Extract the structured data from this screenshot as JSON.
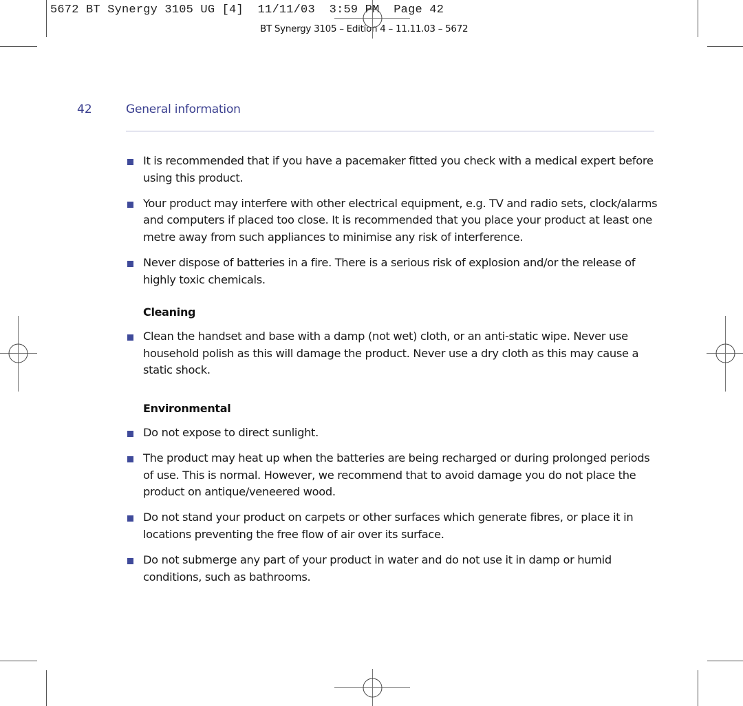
{
  "print_slug": "5672 BT Synergy 3105 UG [4]  11/11/03  3:59 PM  Page 42",
  "edition_line": "BT Synergy 3105 – Edition 4 – 11.11.03 – 5672",
  "header": {
    "page_number": "42",
    "section_title": "General information"
  },
  "intro_bullets": [
    "It is recommended that if you have a pacemaker fitted you check with a medical expert before using this product.",
    "Your product may interfere with other electrical equipment, e.g. TV and radio sets, clock/alarms and computers if placed too close. It is recommended that you place your product at least one metre away from such appliances to minimise any risk of interference.",
    "Never dispose of batteries in a fire. There is a serious risk of explosion and/or the release of highly toxic chemicals."
  ],
  "cleaning": {
    "heading": "Cleaning",
    "bullets": [
      "Clean the handset and base with a damp (not wet) cloth, or an anti-static wipe. Never use household polish as this will damage the product. Never use a dry cloth as this may cause a static shock."
    ]
  },
  "environmental": {
    "heading": "Environmental",
    "bullets": [
      "Do not expose to direct sunlight.",
      "The product may heat up when the batteries are being recharged or during prolonged periods of use. This is normal. However, we recommend that to avoid damage you do not place the product on antique/veneered wood.",
      "Do not stand your product on carpets or other surfaces which generate fibres, or place it in locations preventing the free flow of air over its surface.",
      "Do not submerge any part of your product in water and do not use it in damp or humid conditions, such as bathrooms."
    ]
  },
  "colors": {
    "accent_blue": "#3a3f8f",
    "bullet_blue": "#3f4a9a",
    "rule": "#b8b9d6"
  }
}
